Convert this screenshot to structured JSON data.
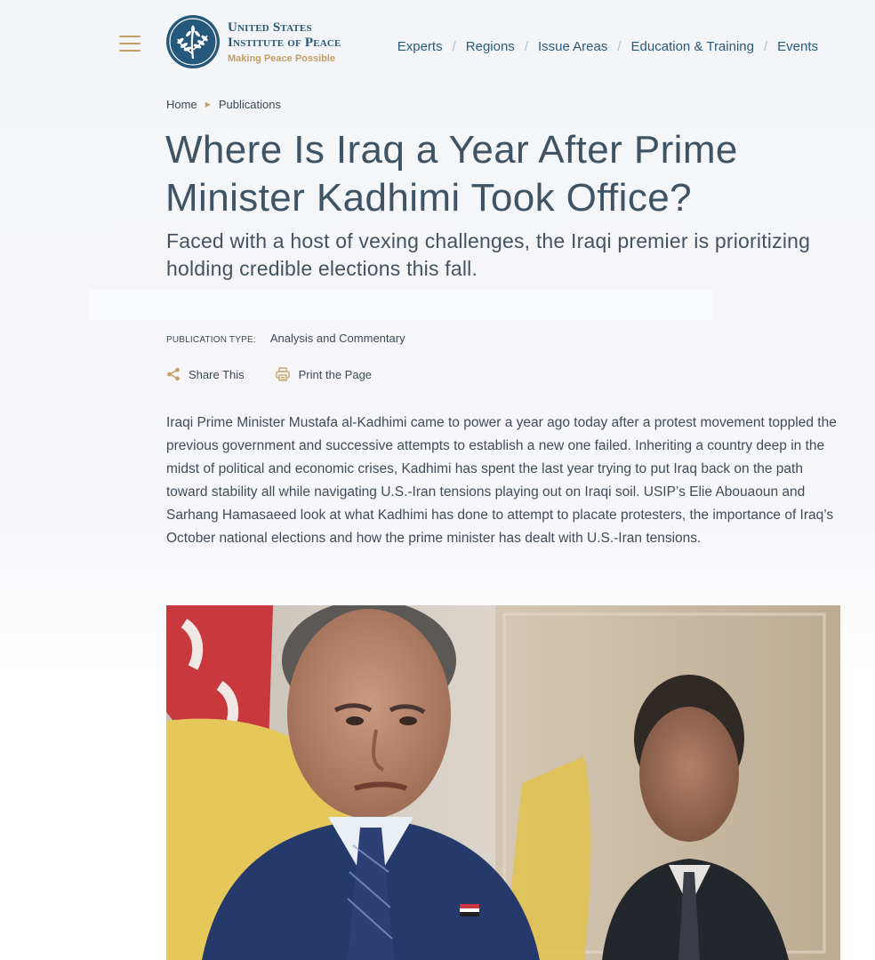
{
  "header": {
    "logo": {
      "line1": "United States",
      "line2": "Institute of Peace",
      "tagline": "Making Peace Possible"
    },
    "nav": [
      {
        "label": "Experts"
      },
      {
        "label": "Regions"
      },
      {
        "label": "Issue Areas"
      },
      {
        "label": "Education & Training"
      },
      {
        "label": "Events"
      }
    ],
    "nav_separator": "/"
  },
  "breadcrumb": {
    "home": "Home",
    "current": "Publications"
  },
  "article": {
    "title": "Where Is Iraq a Year After Prime Minister Kadhimi Took Office?",
    "subtitle": "Faced with a host of vexing challenges, the Iraqi premier is prioritizing holding credible elections this fall.",
    "publication_type_label": "PUBLICATION TYPE:",
    "publication_type": "Analysis and Commentary",
    "share_label": "Share This",
    "print_label": "Print the Page",
    "body": "Iraqi Prime Minister Mustafa al-Kadhimi came to power a year ago today after a protest movement toppled the previous government and successive attempts to establish a new one failed. Inheriting a country deep in the midst of political and economic crises, Kadhimi has spent the last year trying to put Iraq back on the path toward stability all while navigating U.S.-Iran tensions playing out on Iraqi soil. USIP’s Elie Abouaoun and Sarhang Hamasaeed look at what Kadhimi has done to attempt to placate protesters, the importance of Iraq’s October national elections and how the prime minister has dealt with U.S.-Iran tensions."
  },
  "colors": {
    "brand_blue": "#26587b",
    "brand_gold": "#c1a063",
    "nav_link": "#2a5a7c",
    "text": "#404c56"
  },
  "icons": {
    "menu": "hamburger-menu-icon",
    "share": "share-icon",
    "print": "printer-icon",
    "breadcrumb_arrow": "triangle-right-icon"
  }
}
